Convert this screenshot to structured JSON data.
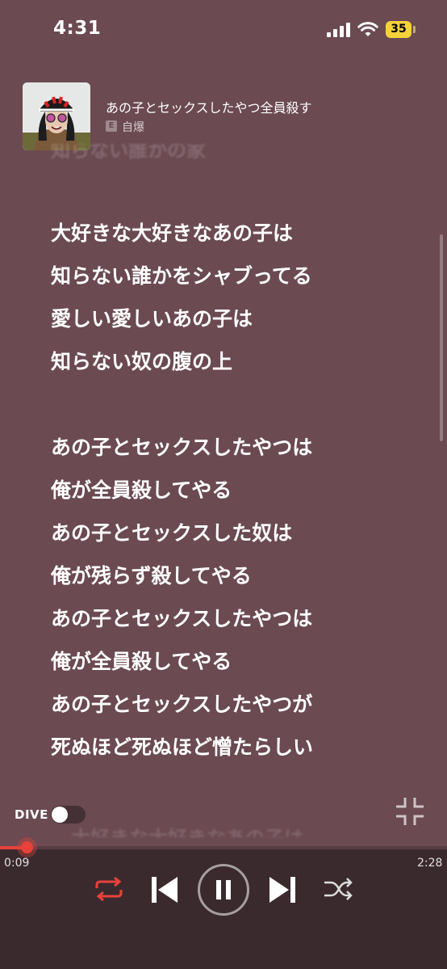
{
  "status_bar": {
    "time": "4:31",
    "battery": "35"
  },
  "now_playing": {
    "title": "あの子とセックスしたやつ全員殺す",
    "explicit": "E",
    "artist": "自爆"
  },
  "lyrics": {
    "faded_previous": "知らない誰かの家",
    "lines": [
      "大好きな大好きなあの子は",
      "知らない誰かをシャブってる",
      "愛しい愛しいあの子は",
      "知らない奴の腹の上",
      "",
      "あの子とセックスしたやつは",
      "俺が全員殺してやる",
      "あの子とセックスした奴は",
      "俺が残らず殺してやる",
      "あの子とセックスしたやつは",
      "俺が全員殺してやる",
      "あの子とセックスしたやつが",
      "死ぬほど死ぬほど憎たらしい"
    ],
    "faded_next": "大好きな大好きなあの子は"
  },
  "dive": {
    "label": "DIVE",
    "enabled": false
  },
  "playback": {
    "elapsed": "0:09",
    "total": "2:28",
    "progress_fraction": 0.06,
    "repeat_active": true,
    "shuffle_active": false,
    "state": "playing"
  },
  "colors": {
    "background": "#6b4a52",
    "player_bar": "#3a2a2e",
    "accent": "#e8413a",
    "battery": "#f4d23a"
  }
}
